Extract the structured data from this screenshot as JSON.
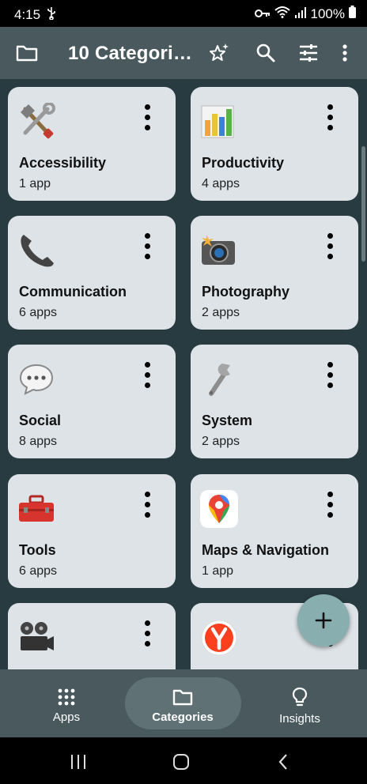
{
  "status": {
    "time": "4:15",
    "battery": "100%"
  },
  "appbar": {
    "title": "10 Categori…"
  },
  "categories": [
    {
      "name": "Accessibility",
      "count": "1 app",
      "icon": "hammer-wrench-icon"
    },
    {
      "name": "Productivity",
      "count": "4 apps",
      "icon": "bar-chart-icon"
    },
    {
      "name": "Communication",
      "count": "6 apps",
      "icon": "telephone-icon"
    },
    {
      "name": "Photography",
      "count": "2 apps",
      "icon": "camera-flash-icon"
    },
    {
      "name": "Social",
      "count": "8 apps",
      "icon": "speech-bubble-icon"
    },
    {
      "name": "System",
      "count": "2 apps",
      "icon": "wrench-icon"
    },
    {
      "name": "Tools",
      "count": "6 apps",
      "icon": "toolbox-icon"
    },
    {
      "name": "Maps & Navigation",
      "count": "1 app",
      "icon": "map-pin-icon"
    },
    {
      "name": "",
      "count": "",
      "icon": "film-projector-icon"
    },
    {
      "name": "",
      "count": "",
      "icon": "yandex-y-icon"
    }
  ],
  "nav": {
    "apps": "Apps",
    "categories": "Categories",
    "insights": "Insights"
  }
}
